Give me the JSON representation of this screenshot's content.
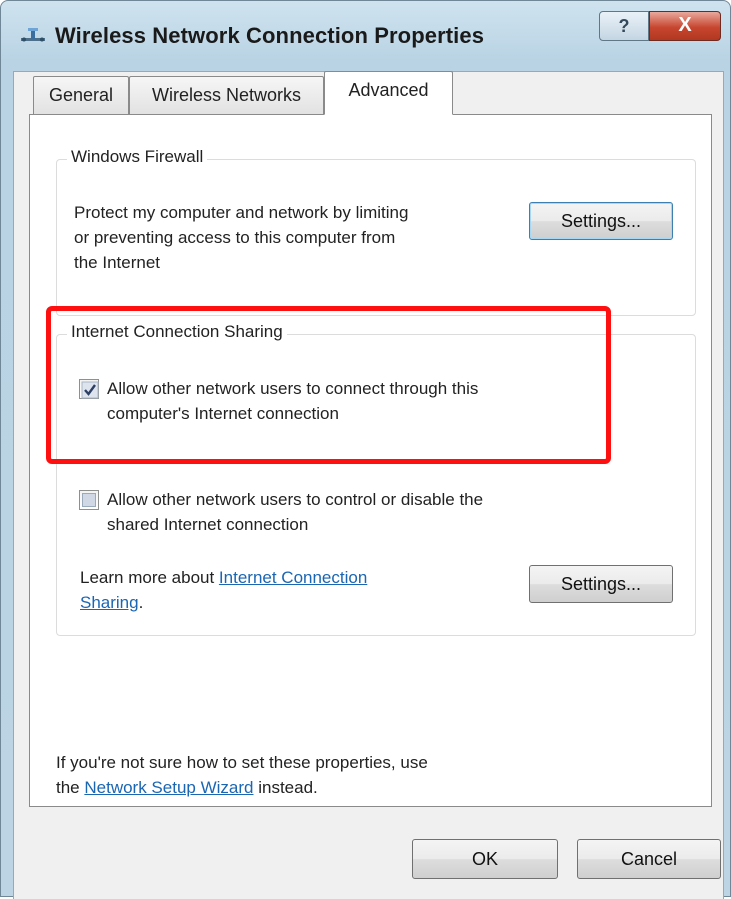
{
  "window": {
    "title": "Wireless Network Connection Properties",
    "icon": "network-connection-icon",
    "help_label": "?",
    "close_label": "X"
  },
  "tabs": [
    {
      "label": "General",
      "active": false
    },
    {
      "label": "Wireless Networks",
      "active": false
    },
    {
      "label": "Advanced",
      "active": true
    }
  ],
  "firewall": {
    "legend": "Windows Firewall",
    "description_line1": "Protect my computer and network by limiting",
    "description_line2": "or preventing access to this computer from",
    "description_line3": "the Internet",
    "settings_label": "Settings..."
  },
  "ics": {
    "legend": "Internet Connection Sharing",
    "allow_connect_line1": "Allow other network users to connect through this",
    "allow_connect_line2": "computer's Internet connection",
    "allow_connect_checked": true,
    "allow_control_line1": "Allow other network users to control or disable the",
    "allow_control_line2": "shared Internet connection",
    "allow_control_checked": false,
    "learn_more_prefix": "Learn more about ",
    "learn_more_link_line1": "Internet Connection",
    "learn_more_link_line2": "Sharing",
    "learn_more_suffix": ".",
    "settings_label": "Settings..."
  },
  "footer_note": {
    "line1": "If you're not sure how to set these properties, use",
    "prefix": "the ",
    "link": "Network Setup Wizard",
    "suffix": " instead."
  },
  "buttons": {
    "ok_label": "OK",
    "cancel_label": "Cancel"
  },
  "colors": {
    "highlight": "#ff1010",
    "link": "#1a66b3",
    "close_button": "#c7462f"
  }
}
